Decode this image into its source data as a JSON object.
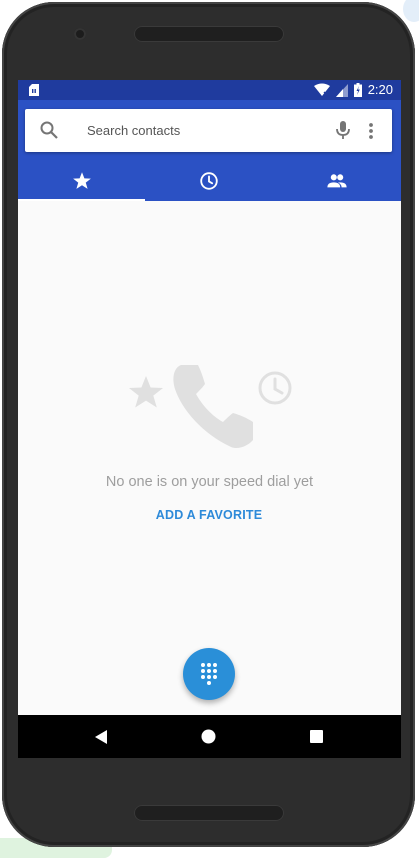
{
  "status_bar": {
    "time": "2:20",
    "icons": [
      "sim-card-icon",
      "wifi-icon",
      "signal-icon",
      "battery-icon"
    ]
  },
  "search": {
    "placeholder": "Search contacts",
    "icons": [
      "search-icon",
      "mic-icon",
      "more-vert-icon"
    ]
  },
  "tabs": [
    {
      "name": "speed-dial",
      "icon": "star-icon",
      "selected": true
    },
    {
      "name": "recents",
      "icon": "clock-icon",
      "selected": false
    },
    {
      "name": "contacts",
      "icon": "people-icon",
      "selected": false
    }
  ],
  "empty_state": {
    "message": "No one is on your speed dial yet",
    "action_label": "ADD A FAVORITE",
    "illustration_icons": [
      "star-icon",
      "phone-icon",
      "clock-icon"
    ]
  },
  "fab": {
    "icon": "dialpad-icon"
  },
  "nav_bar": {
    "icons": [
      "back-icon",
      "home-icon",
      "recents-icon"
    ]
  },
  "colors": {
    "status_bar": "#1f3b9e",
    "app_bar": "#2b51c4",
    "accent": "#2a8fd8",
    "link": "#2d8ad9",
    "empty_text": "#9e9e9e",
    "illustration": "#e0e0e0"
  }
}
